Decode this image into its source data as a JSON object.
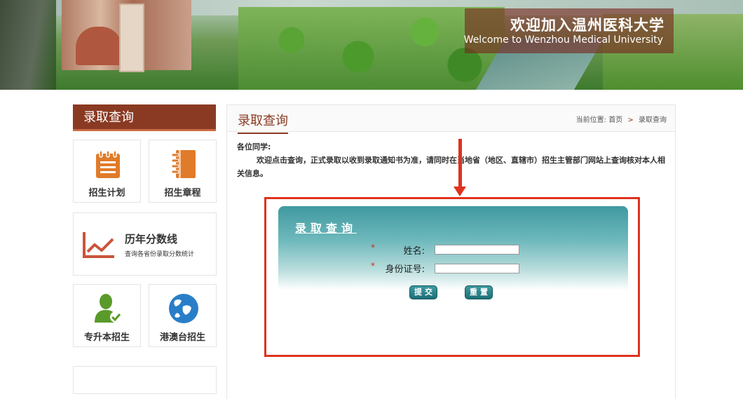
{
  "banner": {
    "title_cn": "欢迎加入温州医科大学",
    "title_en": "Welcome to Wenzhou Medical University"
  },
  "sidebar": {
    "heading": "录取查询",
    "tiles": [
      {
        "label": "招生计划",
        "icon": "clipboard-list-icon"
      },
      {
        "label": "招生章程",
        "icon": "notebook-icon"
      },
      {
        "label": "历年分数线",
        "sub": "查询各省份录取分数统计",
        "icon": "line-chart-icon"
      },
      {
        "label": "专升本招生",
        "icon": "user-check-icon"
      },
      {
        "label": "港澳台招生",
        "icon": "globe-icon"
      }
    ]
  },
  "main": {
    "title": "录取查询",
    "breadcrumb": {
      "prefix": "当前位置:",
      "home": "首页",
      "sep": ">",
      "current": "录取查询"
    },
    "notice": {
      "greeting": "各位同学:",
      "body": "欢迎点击查询，正式录取以收到录取通知书为准，请同时在当地省（地区、直辖市）招生主管部门网站上查询核对本人相关信息。"
    }
  },
  "form": {
    "title": "录取查询",
    "required_mark": "*",
    "name_label": "姓名:",
    "name_value": "",
    "id_label": "身份证号:",
    "id_value": "",
    "submit": "提交",
    "reset": "重置"
  },
  "colors": {
    "brand": "#8a3a22",
    "annotation_red": "#e0321e",
    "panel_teal": "#3f9aa0",
    "icon_orange": "#e07b2a",
    "icon_green": "#5a9a2a",
    "icon_blue": "#2a7ec8"
  }
}
